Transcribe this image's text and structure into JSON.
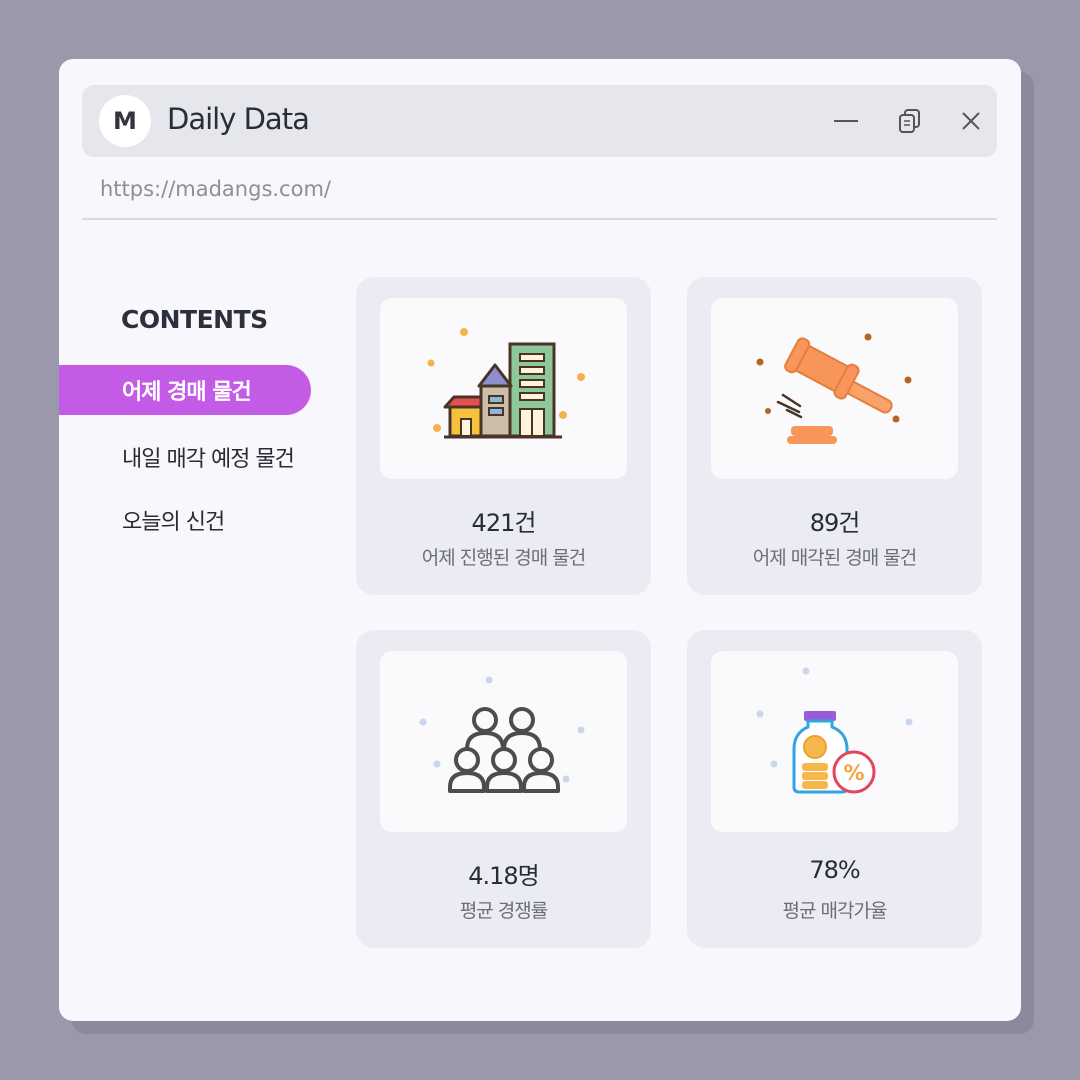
{
  "window": {
    "avatar_letter": "M",
    "title": "Daily Data",
    "url": "https://madangs.com/",
    "controls": [
      "minimize-icon",
      "restore-icon",
      "close-icon"
    ]
  },
  "sidebar": {
    "heading": "CONTENTS",
    "items": [
      {
        "label": "어제 경매 물건",
        "active": true
      },
      {
        "label": "내일 매각 예정 물건",
        "active": false
      },
      {
        "label": "오늘의 신건",
        "active": false
      }
    ]
  },
  "cards": [
    {
      "value": "421건",
      "label": "어제 진행된 경매 물건",
      "icon": "buildings-icon"
    },
    {
      "value": "89건",
      "label": "어제 매각된 경매 물건",
      "icon": "gavel-icon"
    },
    {
      "value": "4.18명",
      "label": "평균 경쟁률",
      "icon": "people-icon"
    },
    {
      "value": "78%",
      "label": "평균 매각가율",
      "icon": "coin-jar-percent-icon"
    }
  ],
  "colors": {
    "accent": "#c45be6",
    "background": "#9999ab",
    "window": "#f7f7fc",
    "card": "#ebebf3"
  }
}
